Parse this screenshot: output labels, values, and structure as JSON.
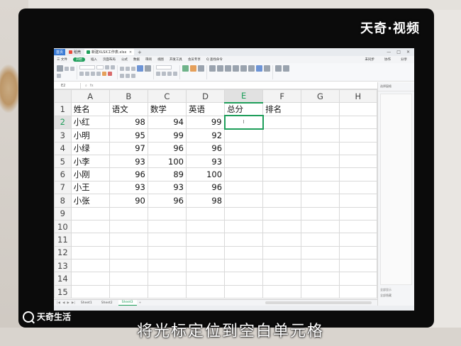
{
  "watermark": {
    "brand_top": "天奇·视频",
    "brand_bottom": "天奇生活"
  },
  "caption": "将光标定位到空白单元格",
  "window": {
    "tabs": [
      {
        "label": "首页"
      },
      {
        "label": "稻壳"
      },
      {
        "label": "新建XLSX工作表.xlsx"
      }
    ]
  },
  "menu": {
    "items": [
      "三 文件",
      "开始",
      "插入",
      "页面布局",
      "公式",
      "数据",
      "审阅",
      "视图",
      "开发工具",
      "会员专享",
      "Q 查找命令"
    ],
    "right": [
      "未同步",
      "协作",
      "分享"
    ]
  },
  "formula_bar": {
    "cell": "E2",
    "fx": "fx"
  },
  "sheet": {
    "columns": [
      "A",
      "B",
      "C",
      "D",
      "E",
      "F",
      "G",
      "H"
    ],
    "selected_column": "E",
    "selected_row": "2",
    "rows": [
      {
        "n": "1",
        "cells": [
          "姓名",
          "语文",
          "数学",
          "英语",
          "总分",
          "排名",
          "",
          ""
        ]
      },
      {
        "n": "2",
        "cells": [
          "小红",
          "98",
          "94",
          "99",
          "",
          "",
          "",
          ""
        ]
      },
      {
        "n": "3",
        "cells": [
          "小明",
          "95",
          "99",
          "92",
          "",
          "",
          "",
          ""
        ]
      },
      {
        "n": "4",
        "cells": [
          "小绿",
          "97",
          "96",
          "96",
          "",
          "",
          "",
          ""
        ]
      },
      {
        "n": "5",
        "cells": [
          "小李",
          "93",
          "100",
          "93",
          "",
          "",
          "",
          ""
        ]
      },
      {
        "n": "6",
        "cells": [
          "小刚",
          "96",
          "89",
          "100",
          "",
          "",
          "",
          ""
        ]
      },
      {
        "n": "7",
        "cells": [
          "小王",
          "93",
          "93",
          "96",
          "",
          "",
          "",
          ""
        ]
      },
      {
        "n": "8",
        "cells": [
          "小张",
          "90",
          "96",
          "98",
          "",
          "",
          "",
          ""
        ]
      },
      {
        "n": "9",
        "cells": [
          "",
          "",
          "",
          "",
          "",
          "",
          "",
          ""
        ]
      },
      {
        "n": "10",
        "cells": [
          "",
          "",
          "",
          "",
          "",
          "",
          "",
          ""
        ]
      },
      {
        "n": "11",
        "cells": [
          "",
          "",
          "",
          "",
          "",
          "",
          "",
          ""
        ]
      },
      {
        "n": "12",
        "cells": [
          "",
          "",
          "",
          "",
          "",
          "",
          "",
          ""
        ]
      },
      {
        "n": "13",
        "cells": [
          "",
          "",
          "",
          "",
          "",
          "",
          "",
          ""
        ]
      },
      {
        "n": "14",
        "cells": [
          "",
          "",
          "",
          "",
          "",
          "",
          "",
          ""
        ]
      },
      {
        "n": "15",
        "cells": [
          "",
          "",
          "",
          "",
          "",
          "",
          "",
          ""
        ]
      }
    ],
    "cursor_glyph": "I",
    "sheet_tabs": [
      "Sheet1",
      "Sheet2",
      "Sheet3"
    ],
    "active_sheet": "Sheet3"
  },
  "task_pane": {
    "title": "选择窗格",
    "footer_left": "全部显示",
    "footer_right": "全部隐藏"
  },
  "colors": {
    "accent": "#1e9e5a",
    "monitor": "#0b0b0b",
    "grid_line": "#d9d9d9"
  }
}
